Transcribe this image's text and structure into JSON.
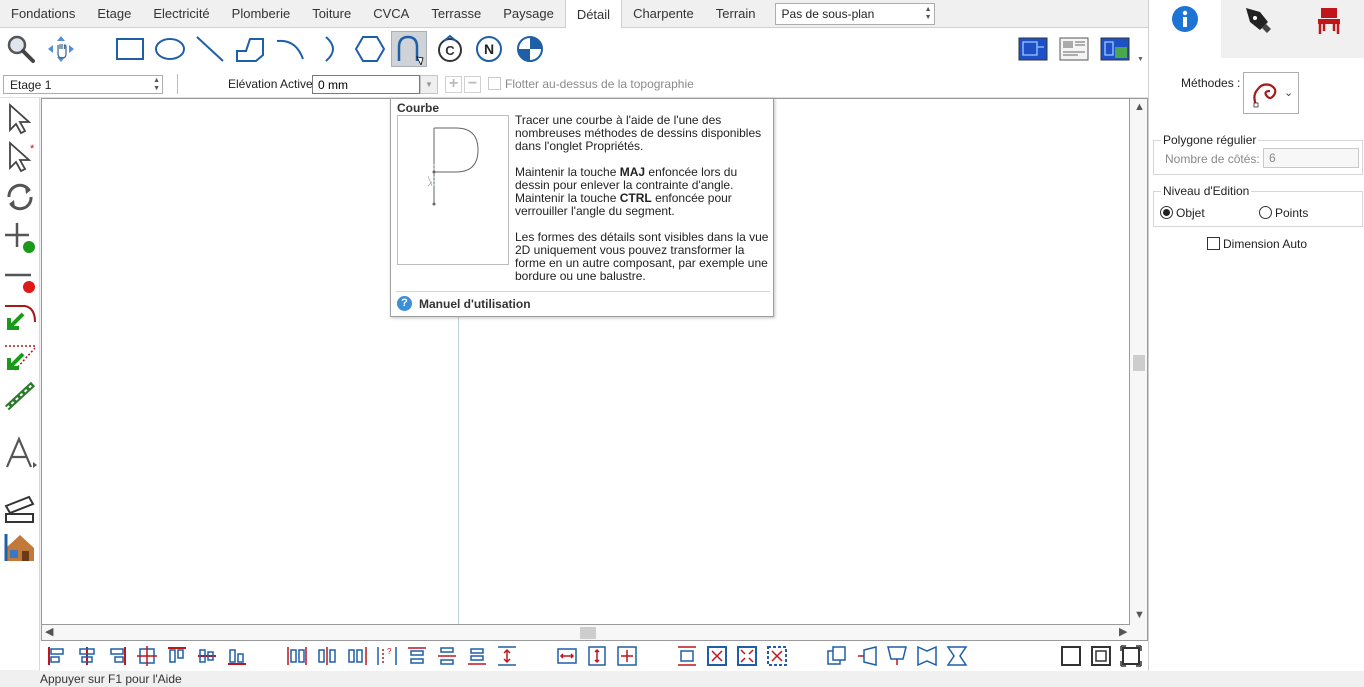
{
  "tabs": [
    {
      "label": "Fondations"
    },
    {
      "label": "Etage"
    },
    {
      "label": "Electricité"
    },
    {
      "label": "Plomberie"
    },
    {
      "label": "Toiture"
    },
    {
      "label": "CVCA"
    },
    {
      "label": "Terrasse"
    },
    {
      "label": "Paysage"
    },
    {
      "label": "Détail"
    },
    {
      "label": "Charpente"
    },
    {
      "label": "Terrain"
    }
  ],
  "active_tab": "Détail",
  "subplan_select": "Pas de sous-plan",
  "tools": {
    "zoom": "zoom-icon",
    "pan": "pan-icon",
    "rectangle": "rectangle-icon",
    "ellipse": "ellipse-icon",
    "line": "line-icon",
    "polyline": "polyline-icon",
    "arc": "arc-icon",
    "half_arc": "half-arc-icon",
    "polygon": "hexagon-icon",
    "curve": "curve-icon",
    "copyright": "copyright-icon",
    "north": "north-icon",
    "quadrant": "quadrant-icon"
  },
  "tool_badges": {
    "copyright": "C",
    "north": "N"
  },
  "levelbar": {
    "level": "Etage 1",
    "elevation_label": "Elévation Active:",
    "elevation_value": "0 mm",
    "float_label": "Flotter au-dessus de la topographie"
  },
  "tooltip": {
    "title": "Courbe",
    "para1": "Tracer une courbe à l'aide de l'une des nombreuses méthodes de dessins disponibles dans l'onglet Propriétés.",
    "p2_a": "Maintenir la touche ",
    "p2_key1": "MAJ",
    "p2_b": " enfoncée lors du dessin pour enlever la contrainte d'angle. Maintenir la touche ",
    "p2_key2": "CTRL",
    "p2_c": " enfoncée pour verrouiller l'angle du segment.",
    "para3": "Les formes des détails sont visibles dans la vue 2D uniquement vous pouvez transformer la forme en un autre composant, par exemple une bordure ou une balustre.",
    "help_icon": "?",
    "help": "Manuel d'utilisation"
  },
  "right_panel": {
    "methods_label": "Méthodes :",
    "polygon_group": "Polygone régulier",
    "sides_label": "Nombre de côtés:",
    "sides_value": "6",
    "edit_group": "Niveau d'Edition",
    "opt_object": "Objet",
    "opt_points": "Points",
    "dim_auto": "Dimension Auto"
  },
  "status": "Appuyer sur F1 pour l'Aide",
  "colors": {
    "accent_blue": "#1f5fa8",
    "info_blue": "#1d74d4",
    "red": "#c0151b",
    "green": "#1a9a1a"
  }
}
